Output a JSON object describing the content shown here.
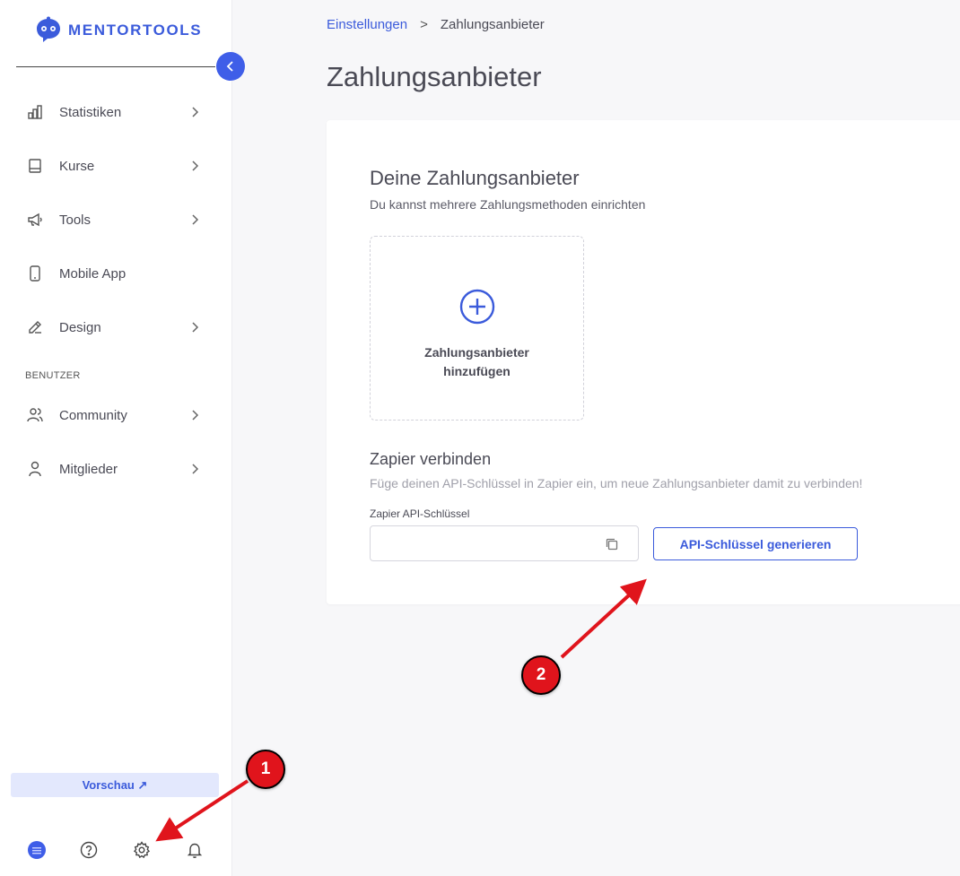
{
  "brand": {
    "name": "MENTORTOOLS",
    "color": "#3b5bdb"
  },
  "sidebar": {
    "items": [
      {
        "label": "Statistiken",
        "icon": "bar-chart-icon",
        "has_submenu": true
      },
      {
        "label": "Kurse",
        "icon": "book-icon",
        "has_submenu": true
      },
      {
        "label": "Tools",
        "icon": "megaphone-icon",
        "has_submenu": true
      },
      {
        "label": "Mobile App",
        "icon": "smartphone-icon",
        "has_submenu": false
      },
      {
        "label": "Design",
        "icon": "pencil-icon",
        "has_submenu": true
      }
    ],
    "section_label": "BENUTZER",
    "user_items": [
      {
        "label": "Community",
        "icon": "users-icon",
        "has_submenu": true
      },
      {
        "label": "Mitglieder",
        "icon": "user-icon",
        "has_submenu": true
      }
    ],
    "preview_label": "Vorschau ↗",
    "bottom_icons": [
      "avatar",
      "help-icon",
      "gear-icon",
      "bell-icon"
    ]
  },
  "breadcrumb": {
    "parent": "Einstellungen",
    "separator": ">",
    "current": "Zahlungsanbieter"
  },
  "page_title": "Zahlungsanbieter",
  "card": {
    "title": "Deine Zahlungsanbieter",
    "subtitle": "Du kannst mehrere Zahlungsmethoden einrichten",
    "add_provider_line1": "Zahlungsanbieter",
    "add_provider_line2": "hinzufügen",
    "zapier_title": "Zapier verbinden",
    "zapier_subtitle": "Füge deinen API-Schlüssel in Zapier ein, um neue Zahlungsanbieter damit zu verbinden!",
    "api_field_label": "Zapier API-Schlüssel",
    "api_field_value": "",
    "generate_button": "API-Schlüssel generieren"
  },
  "annotations": {
    "badge1": "1",
    "badge2": "2",
    "color": "#e0141c"
  }
}
